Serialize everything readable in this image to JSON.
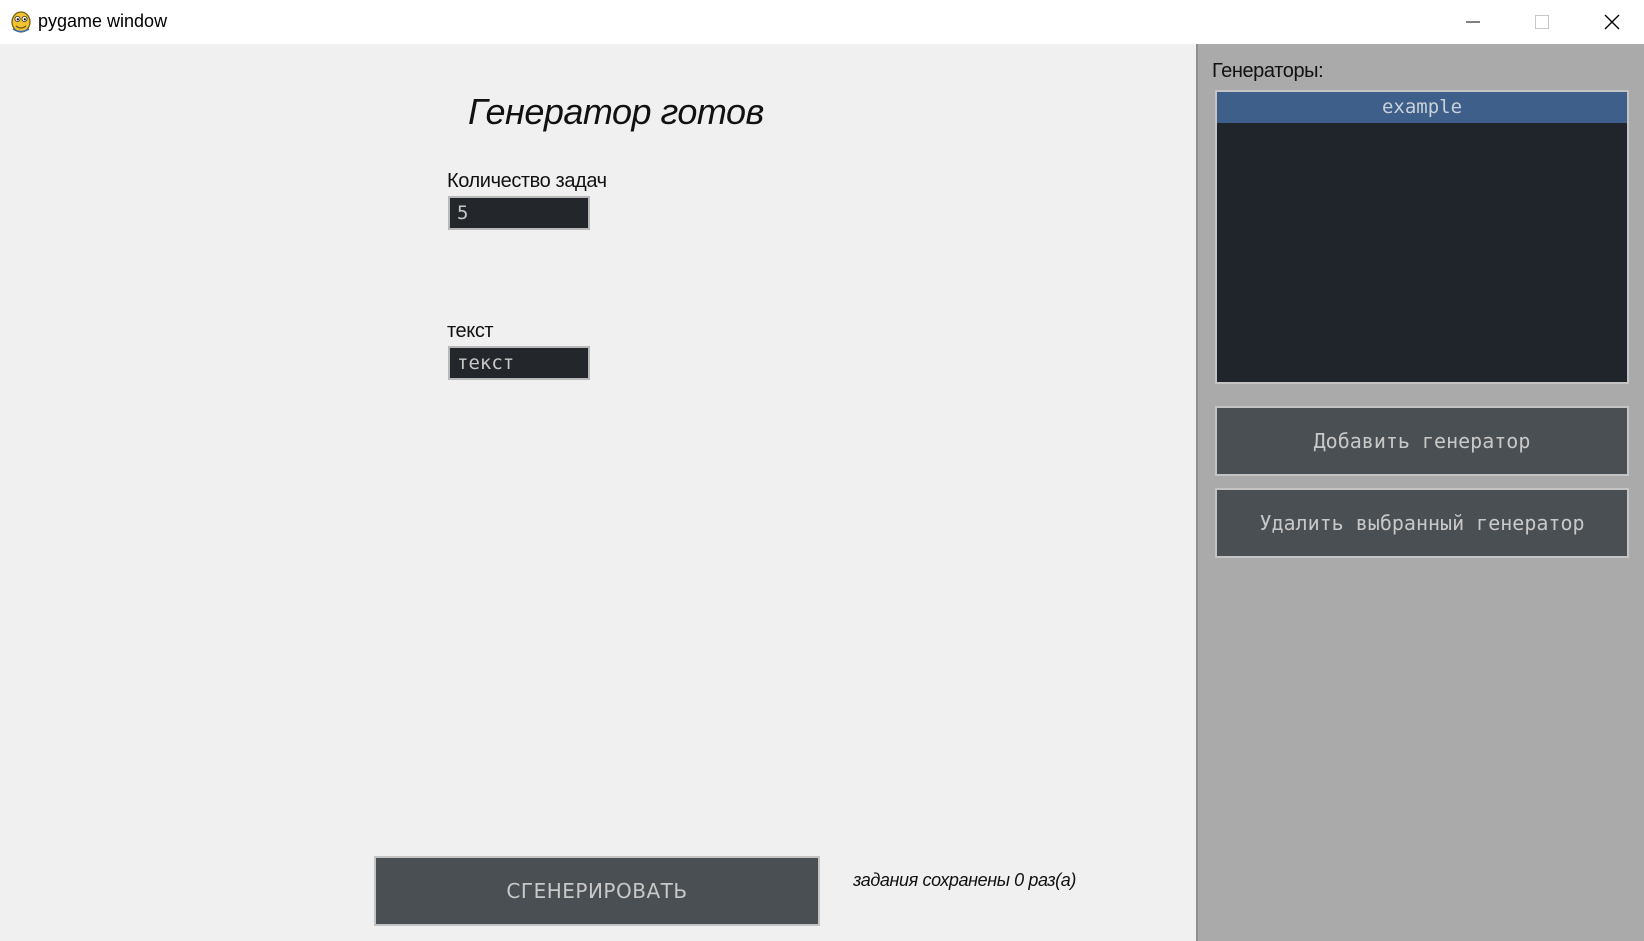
{
  "window": {
    "title": "pygame window",
    "icon": "pygame-snake-icon"
  },
  "main": {
    "heading": "Генератор готов",
    "fields": [
      {
        "label": "Количество задач",
        "value": "5"
      },
      {
        "label": "текст",
        "value": "текст"
      }
    ],
    "generate_label": "СГЕНЕРИРОВАТЬ",
    "saved_status": "задания сохранены 0 раз(а)"
  },
  "sidebar": {
    "title": "Генераторы:",
    "generators": [
      {
        "name": "example",
        "selected": true
      }
    ],
    "add_label": "Добавить генератор",
    "delete_label": "Удалить выбранный генератор"
  },
  "colors": {
    "main_bg": "#f0f0f0",
    "sidebar_bg": "#aaaaaa",
    "list_bg": "#1f252a",
    "selected_bg": "#3e5f8a",
    "button_bg": "#4a4f53",
    "input_bg": "#23272b"
  }
}
